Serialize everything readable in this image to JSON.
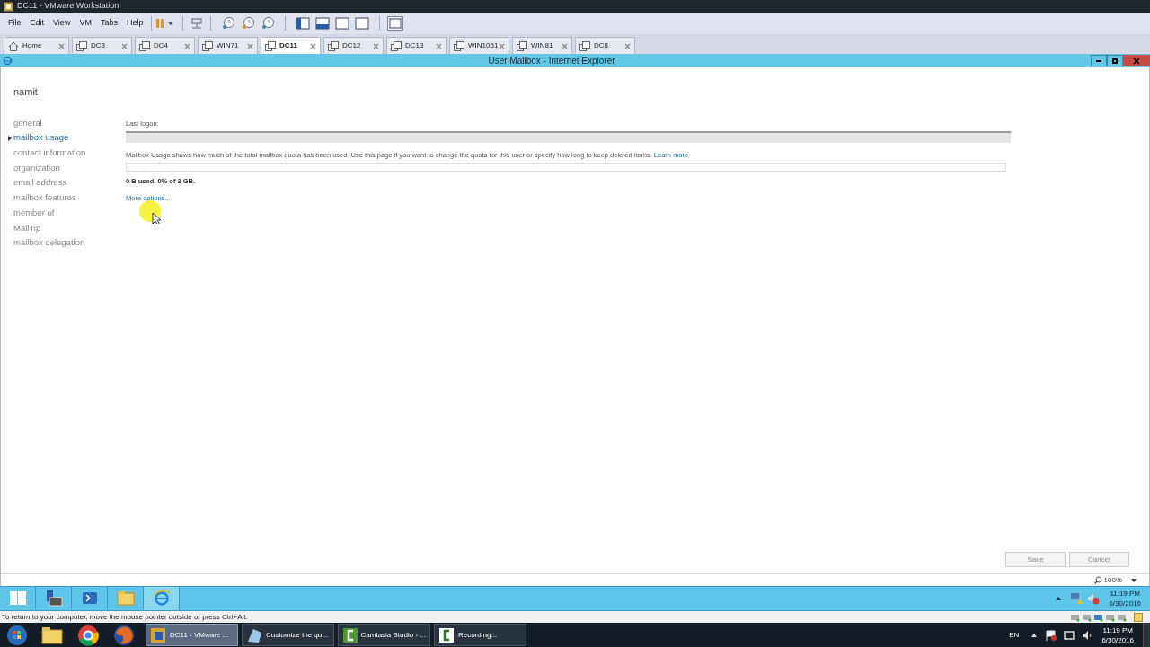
{
  "window": {
    "title": "DC11 - VMware Workstation"
  },
  "menu": [
    "File",
    "Edit",
    "View",
    "VM",
    "Tabs",
    "Help"
  ],
  "vm_tabs": [
    {
      "label": "Home",
      "kind": "home",
      "selected": false
    },
    {
      "label": "DC3",
      "kind": "vm",
      "selected": false
    },
    {
      "label": "DC4",
      "kind": "vm",
      "selected": false
    },
    {
      "label": "WIN71",
      "kind": "vm",
      "selected": false
    },
    {
      "label": "DC11",
      "kind": "vm",
      "selected": true
    },
    {
      "label": "DC12",
      "kind": "vm",
      "selected": false
    },
    {
      "label": "DC13",
      "kind": "vm",
      "selected": false
    },
    {
      "label": "WIN1051",
      "kind": "vm",
      "selected": false
    },
    {
      "label": "WIN81",
      "kind": "vm",
      "selected": false
    },
    {
      "label": "DC8",
      "kind": "vm",
      "selected": false
    }
  ],
  "browser": {
    "title": "User Mailbox - Internet Explorer",
    "zoom": "100%"
  },
  "mailbox": {
    "user": "namit",
    "nav": [
      {
        "label": "general",
        "selected": false
      },
      {
        "label": "mailbox usage",
        "selected": true
      },
      {
        "label": "contact information",
        "selected": false
      },
      {
        "label": "organization",
        "selected": false
      },
      {
        "label": "email address",
        "selected": false
      },
      {
        "label": "mailbox features",
        "selected": false
      },
      {
        "label": "member of",
        "selected": false
      },
      {
        "label": "MailTip",
        "selected": false
      },
      {
        "label": "mailbox delegation",
        "selected": false
      }
    ],
    "last_logon_label": "Last logon:",
    "description": "Mailbox Usage shows how much of the total mailbox quota has been used. Use this page if you want to change the quota for this user or specify how long to keep deleted items.",
    "learn_more": "Learn more",
    "usage": {
      "text": "0 B used, 0% of 3 GB.",
      "level": 0
    },
    "more_options": "More options...",
    "buttons": [
      "Save",
      "Cancel"
    ]
  },
  "guest_taskbar": {
    "time": "11:19 PM",
    "date": "6/30/2016"
  },
  "status_bar": "To return to your computer, move the mouse pointer outside or press Ctrl+Alt.",
  "host_taskbar": {
    "apps": [
      {
        "label": "DC11 - VMware ...",
        "selected": true
      },
      {
        "label": "Customize the qu...",
        "selected": false
      },
      {
        "label": "Camtasia Studio - ...",
        "selected": false
      },
      {
        "label": "Recording...",
        "selected": false
      }
    ],
    "language": "EN",
    "time": "11:19 PM",
    "date": "6/30/2016"
  }
}
